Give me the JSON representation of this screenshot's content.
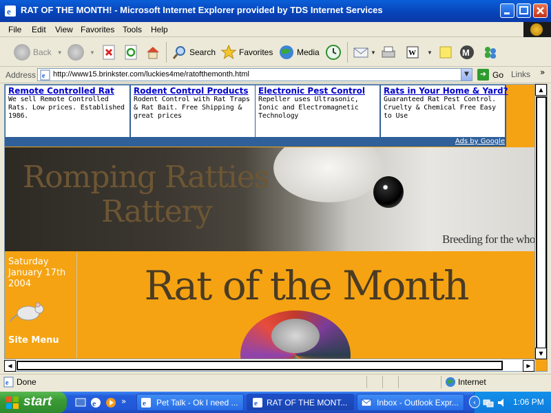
{
  "window": {
    "title": "RAT OF THE MONTH! - Microsoft Internet Explorer provided by TDS Internet Services"
  },
  "menubar": {
    "items": [
      "File",
      "Edit",
      "View",
      "Favorites",
      "Tools",
      "Help"
    ]
  },
  "toolbar": {
    "back_label": "Back",
    "search_label": "Search",
    "favorites_label": "Favorites",
    "media_label": "Media"
  },
  "addressbar": {
    "label": "Address",
    "url": "http://www15.brinkster.com/luckies4me/ratofthemonth.html",
    "go_label": "Go",
    "links_label": "Links"
  },
  "ads": {
    "items": [
      {
        "title": "Remote Controlled Rat",
        "text": "We sell Remote Controlled Rats. Low prices. Established 1986."
      },
      {
        "title": "Rodent Control Products",
        "text": "Rodent Control with Rat Traps & Rat Bait. Free Shipping & great prices"
      },
      {
        "title": "Electronic Pest Control",
        "text": "Repeller uses Ultrasonic, Ionic and Electromagnetic Technology"
      },
      {
        "title": "Rats in Your Home & Yard?",
        "text": "Guaranteed Rat Pest Control. Cruelty & Chemical Free Easy to Use"
      }
    ],
    "ads_by": "Ads by Google"
  },
  "banner": {
    "line1": "Romping Ratties",
    "line2": "Rattery",
    "tagline": "Breeding for the whole"
  },
  "sidebar": {
    "date_line1": "Saturday",
    "date_line2": "January 17th",
    "date_line3": "2004",
    "site_menu": "Site Menu"
  },
  "main": {
    "heading": "Rat of the Month"
  },
  "statusbar": {
    "status": "Done",
    "zone": "Internet"
  },
  "taskbar": {
    "start_label": "start",
    "tasks": [
      "Pet Talk - Ok I need ...",
      "RAT OF THE MONT...",
      "Inbox - Outlook Expr..."
    ],
    "clock": "1:06 PM"
  },
  "colors": {
    "page_bg": "#f5a312",
    "title_blue": "#0a5fd8",
    "ad_link": "#0000cc",
    "heading_brown": "#4a3b24"
  }
}
